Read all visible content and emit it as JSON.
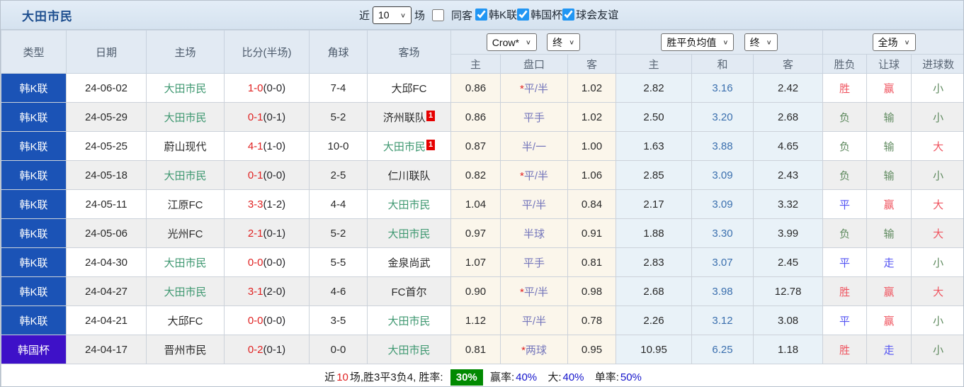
{
  "panel": {
    "title": "大田市民"
  },
  "toolbar": {
    "recent_label": "近",
    "count_select": {
      "value": "10"
    },
    "matches_label": "场",
    "same_away": {
      "label": "同客",
      "checked": false
    },
    "filters": [
      {
        "label": "韩K联",
        "checked": true
      },
      {
        "label": "韩国杯",
        "checked": true
      },
      {
        "label": "球会友谊",
        "checked": true
      }
    ]
  },
  "table": {
    "columns": {
      "type": "类型",
      "date": "日期",
      "home": "主场",
      "score": "比分(半场)",
      "corner": "角球",
      "away": "客场",
      "odds": {
        "company_select": "Crow*",
        "state_select": "终",
        "home": "主",
        "handicap": "盘口",
        "away": "客"
      },
      "avg": {
        "name_select": "胜平负均值",
        "state_select": "终",
        "home": "主",
        "draw": "和",
        "away": "客"
      },
      "result": {
        "scope_select": "全场",
        "wdl": "胜负",
        "handicap": "让球",
        "goals": "进球数"
      }
    },
    "rows": [
      {
        "comp": "韩K联",
        "comp_type": "league",
        "date": "24-06-02",
        "home": "大田市民",
        "home_self": true,
        "home_badge": "",
        "score": "1-0",
        "half": "(0-0)",
        "corner": "7-4",
        "away": "大邱FC",
        "away_self": false,
        "away_badge": "",
        "odds_home": "0.86",
        "handicap_prefix": "*",
        "handicap": "平/半",
        "odds_away": "1.02",
        "avg_home": "2.82",
        "avg_draw": "3.16",
        "avg_away": "2.42",
        "wdl": "胜",
        "wdl_color": "red",
        "let": "赢",
        "let_color": "red",
        "goals": "小",
        "goals_color": "green"
      },
      {
        "comp": "韩K联",
        "comp_type": "league",
        "date": "24-05-29",
        "home": "大田市民",
        "home_self": true,
        "home_badge": "",
        "score": "0-1",
        "half": "(0-1)",
        "corner": "5-2",
        "away": "济州联队",
        "away_self": false,
        "away_badge": "1",
        "odds_home": "0.86",
        "handicap_prefix": "",
        "handicap": "平手",
        "odds_away": "1.02",
        "avg_home": "2.50",
        "avg_draw": "3.20",
        "avg_away": "2.68",
        "wdl": "负",
        "wdl_color": "green",
        "let": "输",
        "let_color": "green",
        "goals": "小",
        "goals_color": "green"
      },
      {
        "comp": "韩K联",
        "comp_type": "league",
        "date": "24-05-25",
        "home": "蔚山现代",
        "home_self": false,
        "home_badge": "",
        "score": "4-1",
        "half": "(1-0)",
        "corner": "10-0",
        "away": "大田市民",
        "away_self": true,
        "away_badge": "1",
        "odds_home": "0.87",
        "handicap_prefix": "",
        "handicap": "半/一",
        "odds_away": "1.00",
        "avg_home": "1.63",
        "avg_draw": "3.88",
        "avg_away": "4.65",
        "wdl": "负",
        "wdl_color": "green",
        "let": "输",
        "let_color": "green",
        "goals": "大",
        "goals_color": "red"
      },
      {
        "comp": "韩K联",
        "comp_type": "league",
        "date": "24-05-18",
        "home": "大田市民",
        "home_self": true,
        "home_badge": "",
        "score": "0-1",
        "half": "(0-0)",
        "corner": "2-5",
        "away": "仁川联队",
        "away_self": false,
        "away_badge": "",
        "odds_home": "0.82",
        "handicap_prefix": "*",
        "handicap": "平/半",
        "odds_away": "1.06",
        "avg_home": "2.85",
        "avg_draw": "3.09",
        "avg_away": "2.43",
        "wdl": "负",
        "wdl_color": "green",
        "let": "输",
        "let_color": "green",
        "goals": "小",
        "goals_color": "green"
      },
      {
        "comp": "韩K联",
        "comp_type": "league",
        "date": "24-05-11",
        "home": "江原FC",
        "home_self": false,
        "home_badge": "",
        "score": "3-3",
        "half": "(1-2)",
        "corner": "4-4",
        "away": "大田市民",
        "away_self": true,
        "away_badge": "",
        "odds_home": "1.04",
        "handicap_prefix": "",
        "handicap": "平/半",
        "odds_away": "0.84",
        "avg_home": "2.17",
        "avg_draw": "3.09",
        "avg_away": "3.32",
        "wdl": "平",
        "wdl_color": "blue",
        "let": "赢",
        "let_color": "red",
        "goals": "大",
        "goals_color": "red"
      },
      {
        "comp": "韩K联",
        "comp_type": "league",
        "date": "24-05-06",
        "home": "光州FC",
        "home_self": false,
        "home_badge": "",
        "score": "2-1",
        "half": "(0-1)",
        "corner": "5-2",
        "away": "大田市民",
        "away_self": true,
        "away_badge": "",
        "odds_home": "0.97",
        "handicap_prefix": "",
        "handicap": "半球",
        "odds_away": "0.91",
        "avg_home": "1.88",
        "avg_draw": "3.30",
        "avg_away": "3.99",
        "wdl": "负",
        "wdl_color": "green",
        "let": "输",
        "let_color": "green",
        "goals": "大",
        "goals_color": "red"
      },
      {
        "comp": "韩K联",
        "comp_type": "league",
        "date": "24-04-30",
        "home": "大田市民",
        "home_self": true,
        "home_badge": "",
        "score": "0-0",
        "half": "(0-0)",
        "corner": "5-5",
        "away": "金泉尚武",
        "away_self": false,
        "away_badge": "",
        "odds_home": "1.07",
        "handicap_prefix": "",
        "handicap": "平手",
        "odds_away": "0.81",
        "avg_home": "2.83",
        "avg_draw": "3.07",
        "avg_away": "2.45",
        "wdl": "平",
        "wdl_color": "blue",
        "let": "走",
        "let_color": "blue",
        "goals": "小",
        "goals_color": "green"
      },
      {
        "comp": "韩K联",
        "comp_type": "league",
        "date": "24-04-27",
        "home": "大田市民",
        "home_self": true,
        "home_badge": "",
        "score": "3-1",
        "half": "(2-0)",
        "corner": "4-6",
        "away": "FC首尔",
        "away_self": false,
        "away_badge": "",
        "odds_home": "0.90",
        "handicap_prefix": "*",
        "handicap": "平/半",
        "odds_away": "0.98",
        "avg_home": "2.68",
        "avg_draw": "3.98",
        "avg_away": "12.78",
        "wdl": "胜",
        "wdl_color": "red",
        "let": "赢",
        "let_color": "red",
        "goals": "大",
        "goals_color": "red"
      },
      {
        "comp": "韩K联",
        "comp_type": "league",
        "date": "24-04-21",
        "home": "大邱FC",
        "home_self": false,
        "home_badge": "",
        "score": "0-0",
        "half": "(0-0)",
        "corner": "3-5",
        "away": "大田市民",
        "away_self": true,
        "away_badge": "",
        "odds_home": "1.12",
        "handicap_prefix": "",
        "handicap": "平/半",
        "odds_away": "0.78",
        "avg_home": "2.26",
        "avg_draw": "3.12",
        "avg_away": "3.08",
        "wdl": "平",
        "wdl_color": "blue",
        "let": "赢",
        "let_color": "red",
        "goals": "小",
        "goals_color": "green"
      },
      {
        "comp": "韩国杯",
        "comp_type": "cup",
        "date": "24-04-17",
        "home": "晋州市民",
        "home_self": false,
        "home_badge": "",
        "score": "0-2",
        "half": "(0-1)",
        "corner": "0-0",
        "away": "大田市民",
        "away_self": true,
        "away_badge": "",
        "odds_home": "0.81",
        "handicap_prefix": "*",
        "handicap": "两球",
        "odds_away": "0.95",
        "avg_home": "10.95",
        "avg_draw": "6.25",
        "avg_away": "1.18",
        "wdl": "胜",
        "wdl_color": "red",
        "let": "走",
        "let_color": "blue",
        "goals": "小",
        "goals_color": "green"
      }
    ],
    "summary": {
      "recent_label": "近",
      "recent_count": "10",
      "stats_text": "场,胜3平3负4, 胜率:",
      "win_rate": "30%",
      "win_odds_label": "赢率:",
      "win_odds_value": "40%",
      "big_label": "大:",
      "big_value": "40%",
      "single_label": "单率:",
      "single_value": "50%"
    }
  }
}
